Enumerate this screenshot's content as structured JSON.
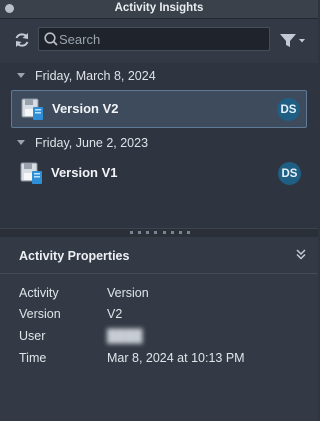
{
  "window": {
    "title": "Activity Insights"
  },
  "toolbar": {
    "refresh_icon": "refresh-icon",
    "search": {
      "placeholder": "Search",
      "value": ""
    },
    "filter_icon": "filter-icon"
  },
  "groups": [
    {
      "date": "Friday, March 8, 2024",
      "items": [
        {
          "name": "Version V2",
          "user_initials": "DS",
          "selected": true
        }
      ]
    },
    {
      "date": "Friday, June 2, 2023",
      "items": [
        {
          "name": "Version V1",
          "user_initials": "DS",
          "selected": false
        }
      ]
    }
  ],
  "properties": {
    "title": "Activity Properties",
    "rows": [
      {
        "key": "Activity",
        "value": "Version"
      },
      {
        "key": "Version",
        "value": "V2"
      },
      {
        "key": "User",
        "value": ""
      },
      {
        "key": "Time",
        "value": "Mar 8, 2024 at 10:13 PM"
      }
    ]
  },
  "colors": {
    "background": "#2e3440",
    "panel": "#343a45",
    "selection": "#3d4b5c",
    "selection_border": "#5d7b96",
    "avatar": "#1f5f84",
    "icon_blue": "#2e8fd8"
  }
}
